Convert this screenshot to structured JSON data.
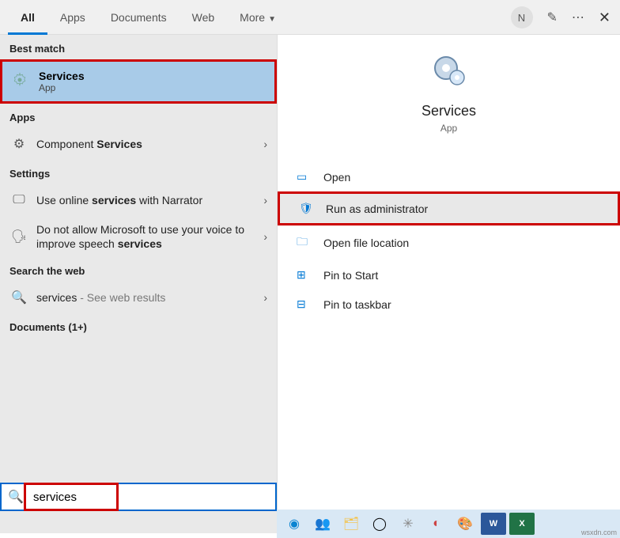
{
  "tabs": {
    "all": "All",
    "apps": "Apps",
    "documents": "Documents",
    "web": "Web",
    "more": "More"
  },
  "header": {
    "avatar_initial": "N"
  },
  "sections": {
    "best_match": "Best match",
    "apps": "Apps",
    "settings": "Settings",
    "search_web": "Search the web",
    "documents": "Documents (1+)"
  },
  "best": {
    "title": "Services",
    "sub": "App"
  },
  "apps_result": {
    "prefix": "Component ",
    "bold": "Services"
  },
  "settings_results": [
    {
      "prefix": "Use online ",
      "bold": "services",
      "suffix": " with Narrator"
    },
    {
      "prefix": "Do not allow Microsoft to use your voice to improve speech ",
      "bold": "services",
      "suffix": ""
    }
  ],
  "web_result": {
    "term": "services",
    "hint": " - See web results"
  },
  "detail": {
    "title": "Services",
    "sub": "App"
  },
  "actions": {
    "open": "Open",
    "run_admin": "Run as administrator",
    "open_location": "Open file location",
    "pin_start": "Pin to Start",
    "pin_taskbar": "Pin to taskbar"
  },
  "search": {
    "value": "services"
  },
  "watermark": "wsxdn.com"
}
